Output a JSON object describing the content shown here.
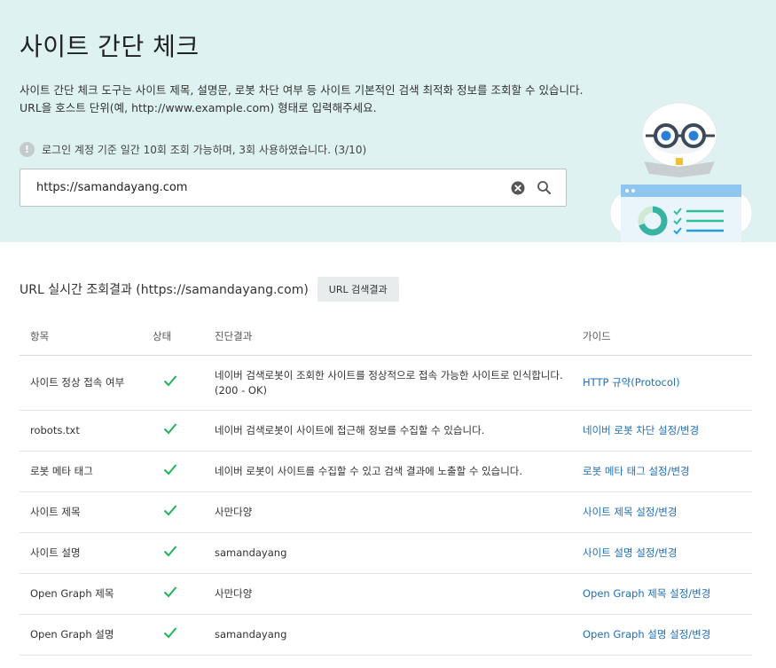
{
  "header": {
    "title": "사이트 간단 체크",
    "description_lines": [
      "사이트 간단 체크 도구는 사이트 제목, 설명문, 로봇 차단 여부 등 사이트 기본적인 검색 최적화 정보를 조회할 수 있습니다.",
      "URL을 호스트 단위(예, http://www.example.com) 형태로 입력해주세요."
    ],
    "notice_icon": "!",
    "notice": "로그인 계정 기준 일간 10회 조회 가능하며, 3회 사용하였습니다. (3/10)"
  },
  "search": {
    "value": "https://samandayang.com",
    "clear_icon": "clear-icon",
    "search_icon": "search-icon"
  },
  "result": {
    "title": "URL 실시간 조회결과 (https://samandayang.com)",
    "button_label": "URL 검색결과",
    "columns": [
      "항목",
      "상태",
      "진단결과",
      "가이드"
    ],
    "rows": [
      {
        "item": "사이트 정상 접속 여부",
        "status": "ok",
        "result_lines": [
          "네이버 검색로봇이 조회한 사이트를 정상적으로 접속 가능한 사이트로 인식합니다.",
          "(200 - OK)"
        ],
        "guide": "HTTP 규약(Protocol)"
      },
      {
        "item": "robots.txt",
        "status": "ok",
        "result_lines": [
          "네이버 검색로봇이 사이트에 접근해 정보를 수집할 수 있습니다."
        ],
        "guide": "네이버 로봇 차단 설정/변경"
      },
      {
        "item": "로봇 메타 태그",
        "status": "ok",
        "result_lines": [
          "네이버 로봇이 사이트를 수집할 수 있고 검색 결과에 노출할 수 있습니다."
        ],
        "guide": "로봇 메타 태그 설정/변경"
      },
      {
        "item": "사이트 제목",
        "status": "ok",
        "result_lines": [
          "사만다양"
        ],
        "guide": "사이트 제목 설정/변경"
      },
      {
        "item": "사이트 설명",
        "status": "ok",
        "result_lines": [
          "samandayang"
        ],
        "guide": "사이트 설명 설정/변경"
      },
      {
        "item": "Open Graph 제목",
        "status": "ok",
        "result_lines": [
          "사만다양"
        ],
        "guide": "Open Graph 제목 설정/변경"
      },
      {
        "item": "Open Graph 설명",
        "status": "ok",
        "result_lines": [
          "samandayang"
        ],
        "guide": "Open Graph 설명 설정/변경"
      }
    ]
  },
  "colors": {
    "hero_bg": "#def3f1",
    "link": "#1f6fb5",
    "check": "#22b45a"
  }
}
